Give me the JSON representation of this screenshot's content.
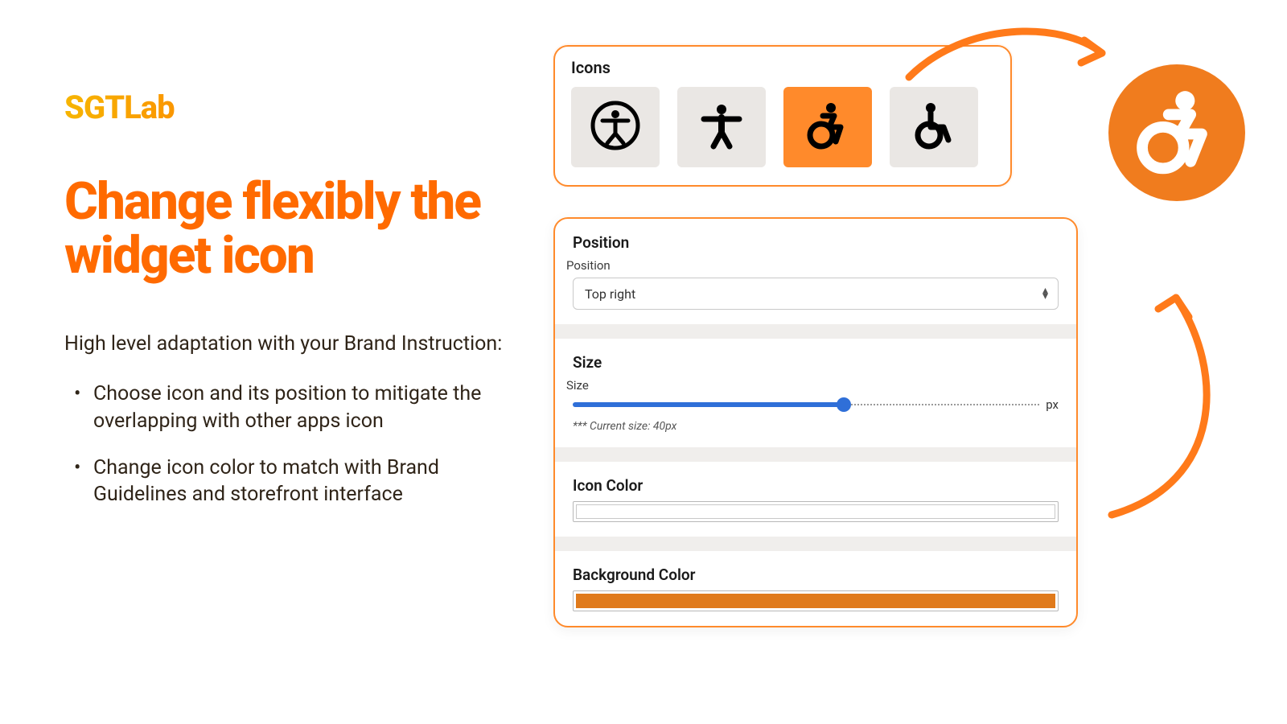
{
  "brand": {
    "logo": "SGTLab"
  },
  "heading": "Change flexibly the widget icon",
  "subhead": "High level adaptation with your Brand Instruction:",
  "bullets": [
    "Choose icon and its position to mitigate the overlapping with other apps icon",
    "Change icon color to match with Brand Guidelines and storefront interface"
  ],
  "icons_panel": {
    "title": "Icons",
    "options": [
      {
        "name": "accessibility-circle-icon",
        "selected": false
      },
      {
        "name": "person-arms-icon",
        "selected": false
      },
      {
        "name": "wheelchair-motion-icon",
        "selected": true
      },
      {
        "name": "wheelchair-icon",
        "selected": false
      }
    ]
  },
  "settings": {
    "position": {
      "title": "Position",
      "label": "Position",
      "value": "Top right"
    },
    "size": {
      "title": "Size",
      "label": "Size",
      "unit": "px",
      "note": "*** Current size: 40px",
      "slider_percent": 58
    },
    "icon_color": {
      "title": "Icon Color",
      "value": "#ffffff"
    },
    "background_color": {
      "title": "Background Color",
      "value": "#e07a1b"
    }
  },
  "preview": {
    "icon": "wheelchair-motion-icon",
    "bg": "#f07c1e"
  }
}
